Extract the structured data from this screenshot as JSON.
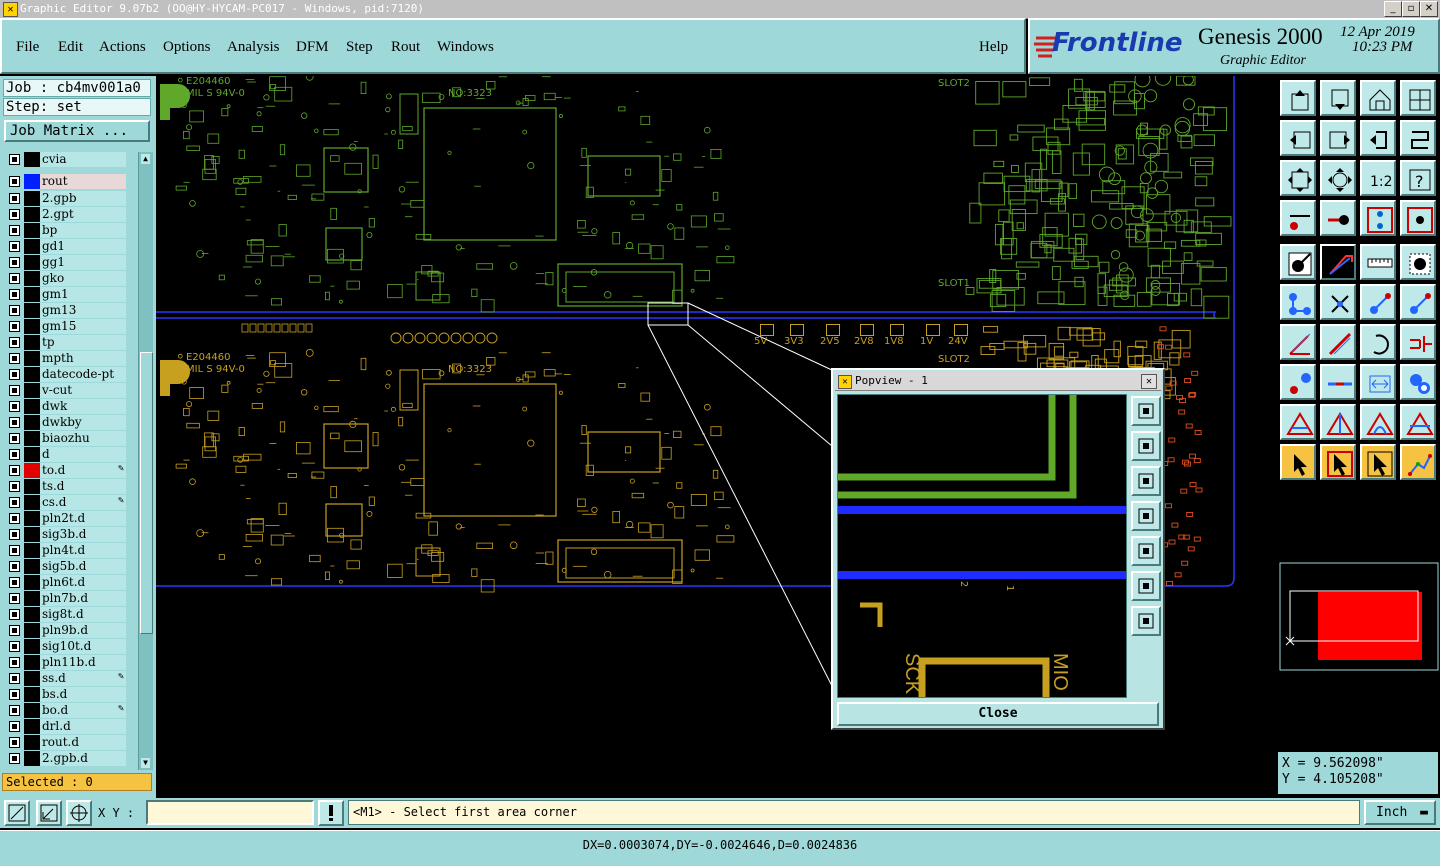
{
  "window": {
    "title": "Graphic Editor 9.07b2 (OO@HY-HYCAM-PC017 - Windows, pid:7120)"
  },
  "menu": [
    "File",
    "Edit",
    "Actions",
    "Options",
    "Analysis",
    "DFM",
    "Step",
    "Rout",
    "Windows"
  ],
  "help_label": "Help",
  "brand": {
    "logo": "Frontline",
    "product": "Genesis 2000",
    "subtitle": "Graphic Editor",
    "date": "12 Apr 2019",
    "time": "10:23 PM"
  },
  "job": {
    "job_label": "Job : cb4mv001a0",
    "step_label": "Step: set",
    "matrix_button": "Job Matrix ..."
  },
  "layers": [
    {
      "name": "cvia",
      "color": "#000000",
      "mark": ""
    },
    {
      "name": "rout",
      "color": "#0020ff",
      "mark": "",
      "highlight": true
    },
    {
      "name": "2.gpb",
      "color": "#000000",
      "mark": ""
    },
    {
      "name": "2.gpt",
      "color": "#000000",
      "mark": ""
    },
    {
      "name": "bp",
      "color": "#000000",
      "mark": ""
    },
    {
      "name": "gd1",
      "color": "#000000",
      "mark": ""
    },
    {
      "name": "gg1",
      "color": "#000000",
      "mark": ""
    },
    {
      "name": "gko",
      "color": "#000000",
      "mark": ""
    },
    {
      "name": "gm1",
      "color": "#000000",
      "mark": ""
    },
    {
      "name": "gm13",
      "color": "#000000",
      "mark": ""
    },
    {
      "name": "gm15",
      "color": "#000000",
      "mark": ""
    },
    {
      "name": "tp",
      "color": "#000000",
      "mark": ""
    },
    {
      "name": "mpth",
      "color": "#000000",
      "mark": ""
    },
    {
      "name": "datecode-pt",
      "color": "#000000",
      "mark": ""
    },
    {
      "name": "v-cut",
      "color": "#000000",
      "mark": ""
    },
    {
      "name": "dwk",
      "color": "#000000",
      "mark": ""
    },
    {
      "name": "dwkby",
      "color": "#000000",
      "mark": ""
    },
    {
      "name": "biaozhu",
      "color": "#000000",
      "mark": ""
    },
    {
      "name": "d",
      "color": "#000000",
      "mark": ""
    },
    {
      "name": "to.d",
      "color": "#e00000",
      "mark": "✎"
    },
    {
      "name": "ts.d",
      "color": "#000000",
      "mark": ""
    },
    {
      "name": "cs.d",
      "color": "#000000",
      "mark": "✎"
    },
    {
      "name": "pln2t.d",
      "color": "#000000",
      "mark": ""
    },
    {
      "name": "sig3b.d",
      "color": "#000000",
      "mark": ""
    },
    {
      "name": "pln4t.d",
      "color": "#000000",
      "mark": ""
    },
    {
      "name": "sig5b.d",
      "color": "#000000",
      "mark": ""
    },
    {
      "name": "pln6t.d",
      "color": "#000000",
      "mark": ""
    },
    {
      "name": "pln7b.d",
      "color": "#000000",
      "mark": ""
    },
    {
      "name": "sig8t.d",
      "color": "#000000",
      "mark": ""
    },
    {
      "name": "pln9b.d",
      "color": "#000000",
      "mark": ""
    },
    {
      "name": "sig10t.d",
      "color": "#000000",
      "mark": ""
    },
    {
      "name": "pln11b.d",
      "color": "#000000",
      "mark": ""
    },
    {
      "name": "ss.d",
      "color": "#000000",
      "mark": "✎"
    },
    {
      "name": "bs.d",
      "color": "#000000",
      "mark": ""
    },
    {
      "name": "bo.d",
      "color": "#000000",
      "mark": "✎"
    },
    {
      "name": "drl.d",
      "color": "#000000",
      "mark": ""
    },
    {
      "name": "rout.d",
      "color": "#000000",
      "mark": ""
    },
    {
      "name": "2.gpb.d",
      "color": "#000000",
      "mark": ""
    }
  ],
  "selected": "Selected : 0",
  "board": {
    "texts_green": [
      "E204460",
      "MIL S 94V-0",
      "NO:3323",
      "SLOT2",
      "SLOT1"
    ],
    "texts_yellow": [
      "E204460",
      "MIL S 94V-0",
      "NO:3323",
      "SLOT2"
    ],
    "voltages": [
      "5V",
      "3V3",
      "2V5",
      "2V8",
      "1V8",
      "1V",
      "24V"
    ]
  },
  "popview": {
    "title": "Popview - 1",
    "close_label": "Close",
    "labels": [
      "SCK",
      "MIO",
      "2",
      "1"
    ]
  },
  "coords": {
    "x": "X = 9.562098\"",
    "y": "Y = 4.105208\""
  },
  "bottom": {
    "xy_label": "X Y :",
    "xy_value": "",
    "prompt": "<M1> - Select first area corner",
    "unit": "Inch"
  },
  "status": "DX=0.0003074,DY=-0.0024646,D=0.0024836",
  "colors": {
    "panel": "#9ed8d8",
    "green_layer": "#5fa82a",
    "yellow_layer": "#c8a020",
    "rout_blue": "#1e2cff",
    "highlight": "#f5c242"
  }
}
